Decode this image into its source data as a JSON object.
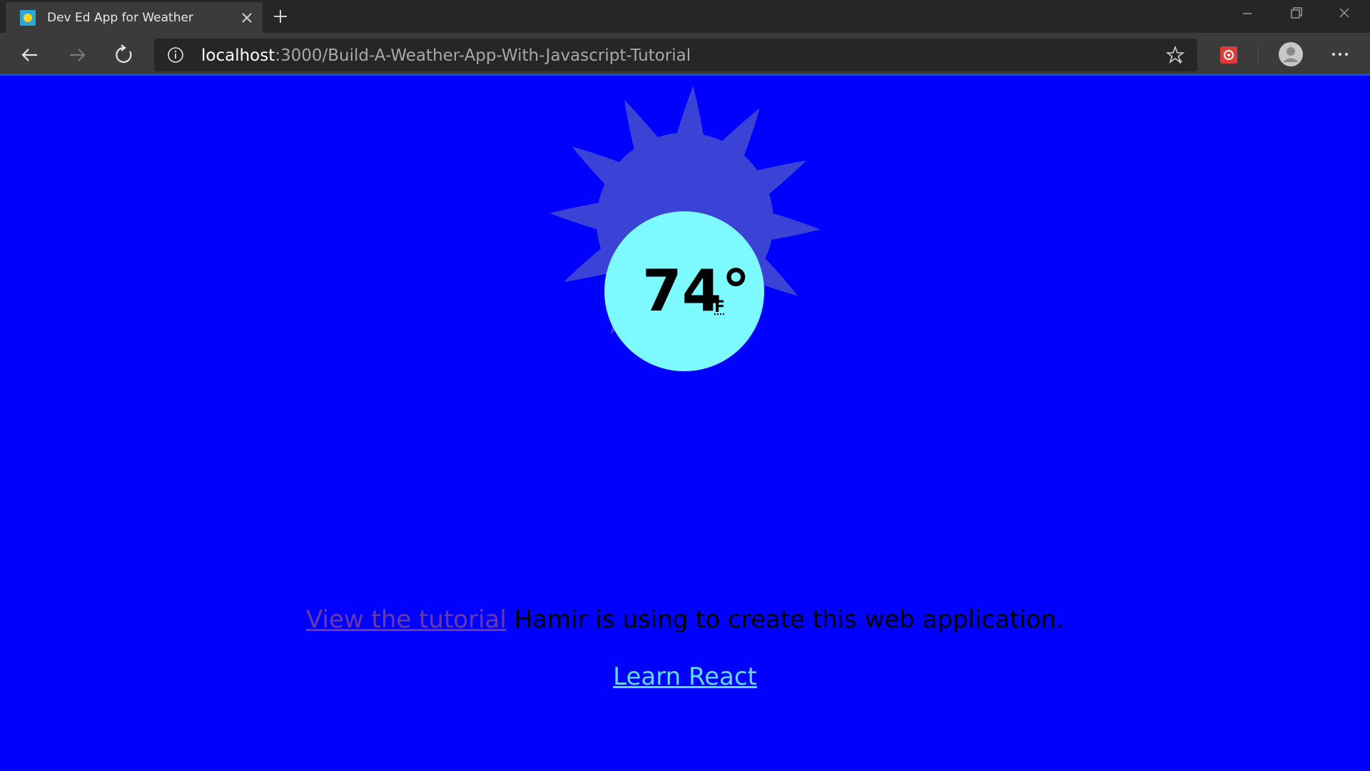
{
  "browser": {
    "tab_title": "Dev Ed App for Weather",
    "url_host": "localhost",
    "url_rest": ":3000/Build-A-Weather-App-With-Javascript-Tutorial"
  },
  "weather": {
    "temperature": "74°",
    "unit": "F",
    "icon": "sun-icon"
  },
  "content": {
    "tutorial_link": "View the tutorial",
    "tutorial_text": " Hamir is using to create this web application.",
    "learn_react": "Learn React"
  },
  "colors": {
    "page_background": "#0000ff",
    "sun_rays": "#3a43d6",
    "sun_core": "#7dfaff",
    "visited_link": "#6a3aa6",
    "react_link": "#61dafb"
  }
}
